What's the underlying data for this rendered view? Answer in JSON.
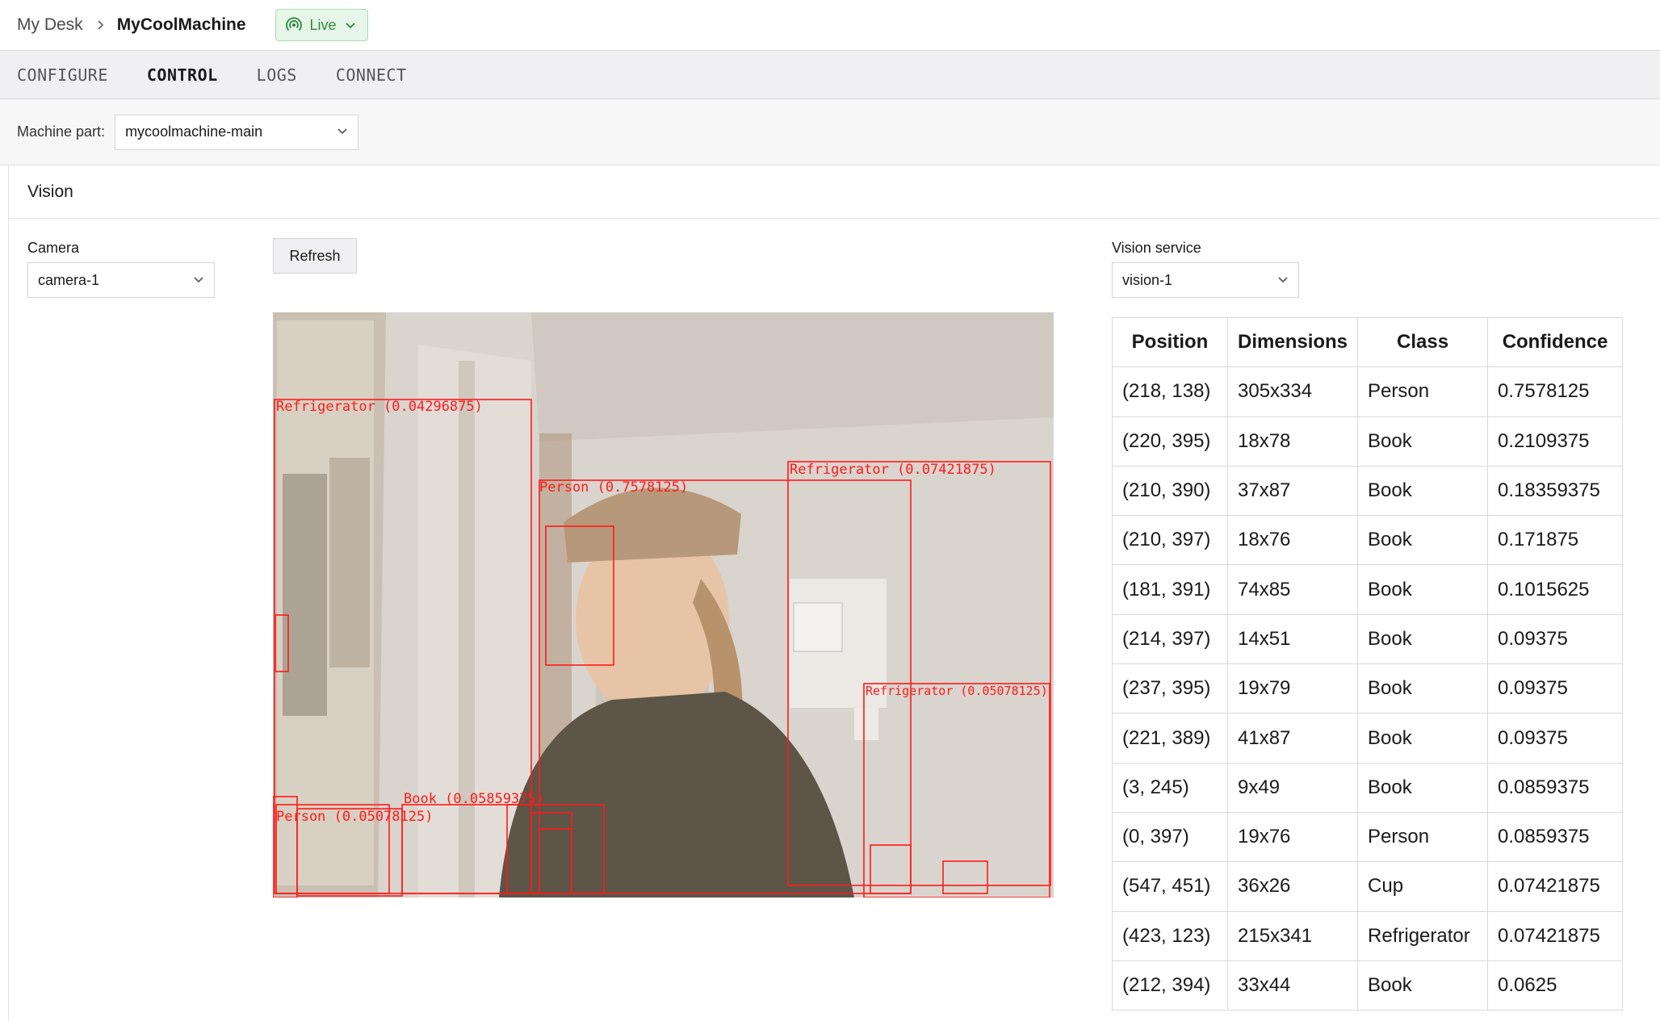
{
  "breadcrumb": {
    "root": "My Desk",
    "current": "MyCoolMachine"
  },
  "status": {
    "label": "Live",
    "color": "#2d8a3d"
  },
  "tabs": [
    {
      "label": "CONFIGURE",
      "active": false
    },
    {
      "label": "CONTROL",
      "active": true
    },
    {
      "label": "LOGS",
      "active": false
    },
    {
      "label": "CONNECT",
      "active": false
    }
  ],
  "machine_part": {
    "label": "Machine part:",
    "value": "mycoolmachine-main"
  },
  "vision_card": {
    "title": "Vision",
    "camera_label": "Camera",
    "camera_value": "camera-1",
    "refresh_label": "Refresh",
    "service_label": "Vision service",
    "service_value": "vision-1"
  },
  "overlay_labels": {
    "fridge1": "Refrigerator (0.04296875)",
    "person1": "Person (0.7578125)",
    "fridge2": "Refrigerator (0.07421875)",
    "fridge3": "Refrigerator (0.05078125)",
    "person2": "Person (0.05078125)",
    "book1": "Book (0.05859375)"
  },
  "detections": {
    "headers": [
      "Position",
      "Dimensions",
      "Class",
      "Confidence"
    ],
    "rows": [
      [
        "(218, 138)",
        "305x334",
        "Person",
        "0.7578125"
      ],
      [
        "(220, 395)",
        "18x78",
        "Book",
        "0.2109375"
      ],
      [
        "(210, 390)",
        "37x87",
        "Book",
        "0.18359375"
      ],
      [
        "(210, 397)",
        "18x76",
        "Book",
        "0.171875"
      ],
      [
        "(181, 391)",
        "74x85",
        "Book",
        "0.1015625"
      ],
      [
        "(214, 397)",
        "14x51",
        "Book",
        "0.09375"
      ],
      [
        "(237, 395)",
        "19x79",
        "Book",
        "0.09375"
      ],
      [
        "(221, 389)",
        "41x87",
        "Book",
        "0.09375"
      ],
      [
        "(3, 245)",
        "9x49",
        "Book",
        "0.0859375"
      ],
      [
        "(0, 397)",
        "19x76",
        "Person",
        "0.0859375"
      ],
      [
        "(547, 451)",
        "36x26",
        "Cup",
        "0.07421875"
      ],
      [
        "(423, 123)",
        "215x341",
        "Refrigerator",
        "0.07421875"
      ],
      [
        "(212, 394)",
        "33x44",
        "Book",
        "0.0625"
      ]
    ]
  },
  "colors": {
    "box_stroke": "#ff1a1a",
    "live_bg": "#e6f6e8"
  }
}
